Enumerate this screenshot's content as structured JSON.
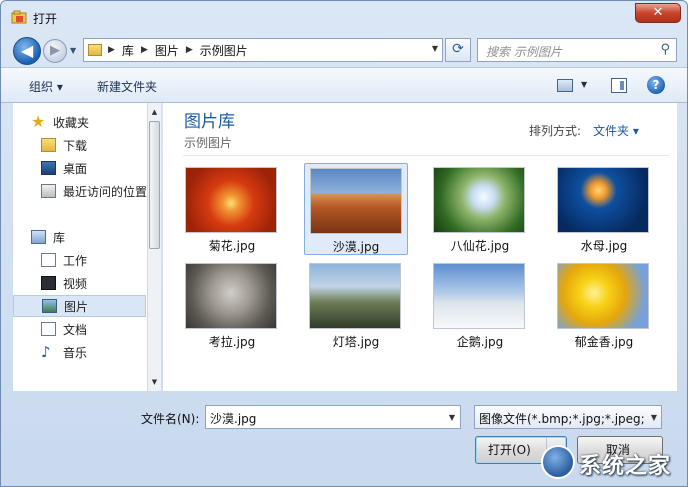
{
  "window": {
    "title": "打开",
    "close": "✕"
  },
  "nav": {
    "back": "◀",
    "forward": "▶",
    "breadcrumb": [
      "库",
      "图片",
      "示例图片"
    ],
    "search_placeholder": "搜索 示例图片"
  },
  "toolbar": {
    "organize": "组织 ▾",
    "new_folder": "新建文件夹",
    "help": "?"
  },
  "sidebar": {
    "favorites_header": "收藏夹",
    "favorites": [
      {
        "label": "下载",
        "icon": "download-folder-icon"
      },
      {
        "label": "桌面",
        "icon": "desktop-icon"
      },
      {
        "label": "最近访问的位置",
        "icon": "recent-places-icon"
      }
    ],
    "libraries_header": "库",
    "libraries": [
      {
        "label": "工作",
        "icon": "work-icon"
      },
      {
        "label": "视频",
        "icon": "videos-icon"
      },
      {
        "label": "图片",
        "icon": "pictures-icon",
        "selected": true
      },
      {
        "label": "文档",
        "icon": "documents-icon"
      },
      {
        "label": "音乐",
        "icon": "music-icon"
      }
    ]
  },
  "content": {
    "title": "图片库",
    "subtitle": "示例图片",
    "arrange_label": "排列方式:",
    "arrange_value": "文件夹 ▾",
    "files": [
      {
        "name": "菊花.jpg",
        "image": "chrysanthemum"
      },
      {
        "name": "沙漠.jpg",
        "image": "desert",
        "selected": true
      },
      {
        "name": "八仙花.jpg",
        "image": "hydrangea"
      },
      {
        "name": "水母.jpg",
        "image": "jellyfish"
      },
      {
        "name": "考拉.jpg",
        "image": "koala"
      },
      {
        "name": "灯塔.jpg",
        "image": "lighthouse"
      },
      {
        "name": "企鹅.jpg",
        "image": "penguins"
      },
      {
        "name": "郁金香.jpg",
        "image": "tulips"
      }
    ]
  },
  "footer": {
    "filename_label": "文件名(N):",
    "filename_value": "沙漠.jpg",
    "filetype_value": "图像文件(*.bmp;*.jpg;*.jpeg;*.",
    "open_label": "打开(O)",
    "cancel_label": "取消"
  },
  "watermark": {
    "text": "系统之家"
  },
  "colors": {
    "accent": "#1e5aa0",
    "selection": "#dfeafa",
    "close": "#c9442b"
  }
}
